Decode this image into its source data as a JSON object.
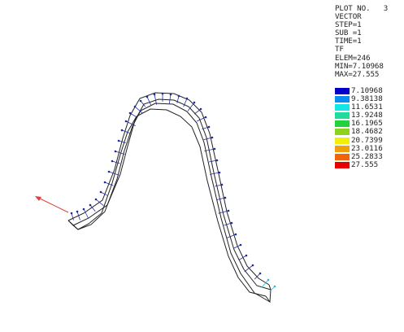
{
  "plot": {
    "plot_no_label": "PLOT NO.   3",
    "type_label": "VECTOR",
    "step_label": "STEP=1",
    "sub_label": "SUB =1",
    "time_label": "TIME=1",
    "item_label": "TF",
    "elem_label": "ELEM=246",
    "min_label": "MIN=7.10968",
    "max_label": "MAX=27.555"
  },
  "legend": {
    "entries": [
      {
        "value": "7.10968",
        "color": "#0000c8"
      },
      {
        "value": "9.38138",
        "color": "#0a8cf0"
      },
      {
        "value": "11.6531",
        "color": "#12e6e6"
      },
      {
        "value": "13.9248",
        "color": "#1edca0"
      },
      {
        "value": "16.1965",
        "color": "#22d23c"
      },
      {
        "value": "18.4682",
        "color": "#8cd21e"
      },
      {
        "value": "20.7399",
        "color": "#f0f00a"
      },
      {
        "value": "23.0116",
        "color": "#f0a00a"
      },
      {
        "value": "25.2833",
        "color": "#f0640a"
      },
      {
        "value": "27.555",
        "color": "#e60000"
      }
    ]
  },
  "colors": {
    "vector_main": "#1f2a9e",
    "vector_end": "#20b8e0",
    "triad": "#d9433c",
    "outline": "#222222"
  }
}
